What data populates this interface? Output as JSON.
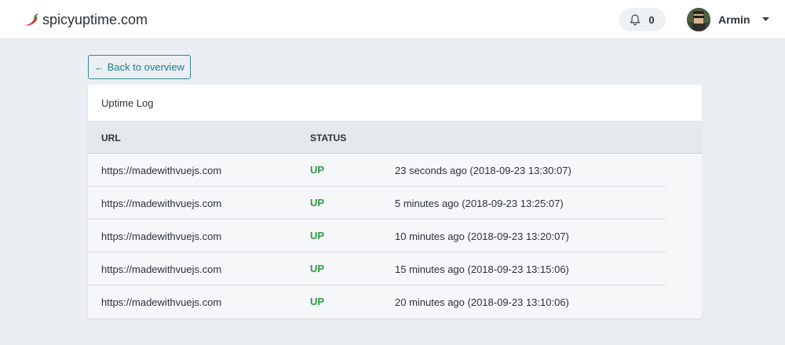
{
  "colors": {
    "page_bg": "#ebeff3",
    "accent": "#1f7d8e",
    "status_up": "#2e9a47"
  },
  "header": {
    "brand": "spicyuptime.com",
    "brand_icon": "chili-pepper-icon",
    "notifications_count": "0",
    "notifications_icon": "bell-icon",
    "user_name": "Armin",
    "user_menu_icon": "caret-down-icon"
  },
  "back_button": {
    "label": "← Back to overview"
  },
  "log": {
    "title": "Uptime Log",
    "columns": {
      "url": "URL",
      "status": "STATUS"
    },
    "rows": [
      {
        "url": "https://madewithvuejs.com",
        "status": "UP",
        "time": "23 seconds ago (2018-09-23 13:30:07)"
      },
      {
        "url": "https://madewithvuejs.com",
        "status": "UP",
        "time": "5 minutes ago (2018-09-23 13:25:07)"
      },
      {
        "url": "https://madewithvuejs.com",
        "status": "UP",
        "time": "10 minutes ago (2018-09-23 13:20:07)"
      },
      {
        "url": "https://madewithvuejs.com",
        "status": "UP",
        "time": "15 minutes ago (2018-09-23 13:15:06)"
      },
      {
        "url": "https://madewithvuejs.com",
        "status": "UP",
        "time": "20 minutes ago (2018-09-23 13:10:06)"
      }
    ]
  }
}
